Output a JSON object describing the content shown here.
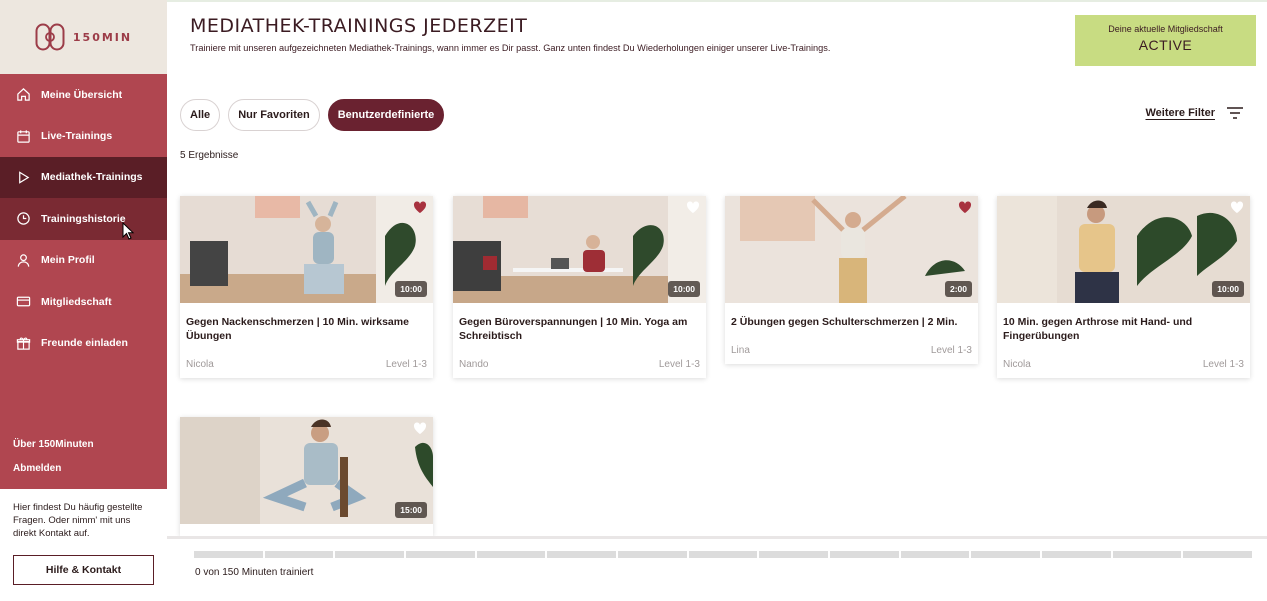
{
  "brand": {
    "name": "150MIN"
  },
  "sidebar": {
    "items": [
      {
        "label": "Meine Übersicht",
        "icon": "home-icon"
      },
      {
        "label": "Live-Trainings",
        "icon": "calendar-icon"
      },
      {
        "label": "Mediathek-Trainings",
        "icon": "play-icon"
      },
      {
        "label": "Trainingshistorie",
        "icon": "clock-icon"
      },
      {
        "label": "Mein Profil",
        "icon": "user-icon"
      },
      {
        "label": "Mitgliedschaft",
        "icon": "card-icon"
      },
      {
        "label": "Freunde einladen",
        "icon": "gift-icon"
      }
    ],
    "links": {
      "about": "Über 150Minuten",
      "logout": "Abmelden"
    },
    "help": {
      "text": "Hier findest Du häufig gestellte Fragen. Oder nimm' mit uns direkt Kontakt auf.",
      "button": "Hilfe & Kontakt"
    }
  },
  "header": {
    "title": "MEDIATHEK-TRAININGS JEDERZEIT",
    "subtitle": "Trainiere mit unseren aufgezeichneten Mediathek-Trainings, wann immer es Dir passt. Ganz unten findest Du Wiederholungen einiger unserer Live-Trainings.",
    "membership_label": "Deine aktuelle Mitgliedschaft",
    "membership_value": "ACTIVE"
  },
  "filters": {
    "all": "Alle",
    "favorites": "Nur Favoriten",
    "custom": "Benutzerdefinierte",
    "more": "Weitere Filter"
  },
  "results": "5 Ergebnisse",
  "cards": [
    {
      "title": "Gegen Nackenschmerzen | 10 Min. wirksame Übungen",
      "trainer": "Nicola",
      "level": "Level 1-3",
      "duration": "10:00",
      "favorite": true
    },
    {
      "title": "Gegen Büroverspannungen | 10 Min. Yoga am Schreibtisch",
      "trainer": "Nando",
      "level": "Level 1-3",
      "duration": "10:00",
      "favorite": false
    },
    {
      "title": "2 Übungen gegen Schulterschmerzen | 2 Min.",
      "trainer": "Lina",
      "level": "Level 1-3",
      "duration": "2:00",
      "favorite": true
    },
    {
      "title": "10 Min. gegen Arthrose mit Hand- und Fingerübungen",
      "trainer": "Nicola",
      "level": "Level 1-3",
      "duration": "10:00",
      "favorite": false
    },
    {
      "duration": "15:00"
    }
  ],
  "progress": {
    "text": "0 von 150 Minuten trainiert",
    "value": 0
  },
  "colors": {
    "sidebar": "#b04650",
    "active": "#5a1e26",
    "accent_chip": "#6a2230",
    "membership": "#c8dc82",
    "heart_filled": "#a8323f"
  }
}
